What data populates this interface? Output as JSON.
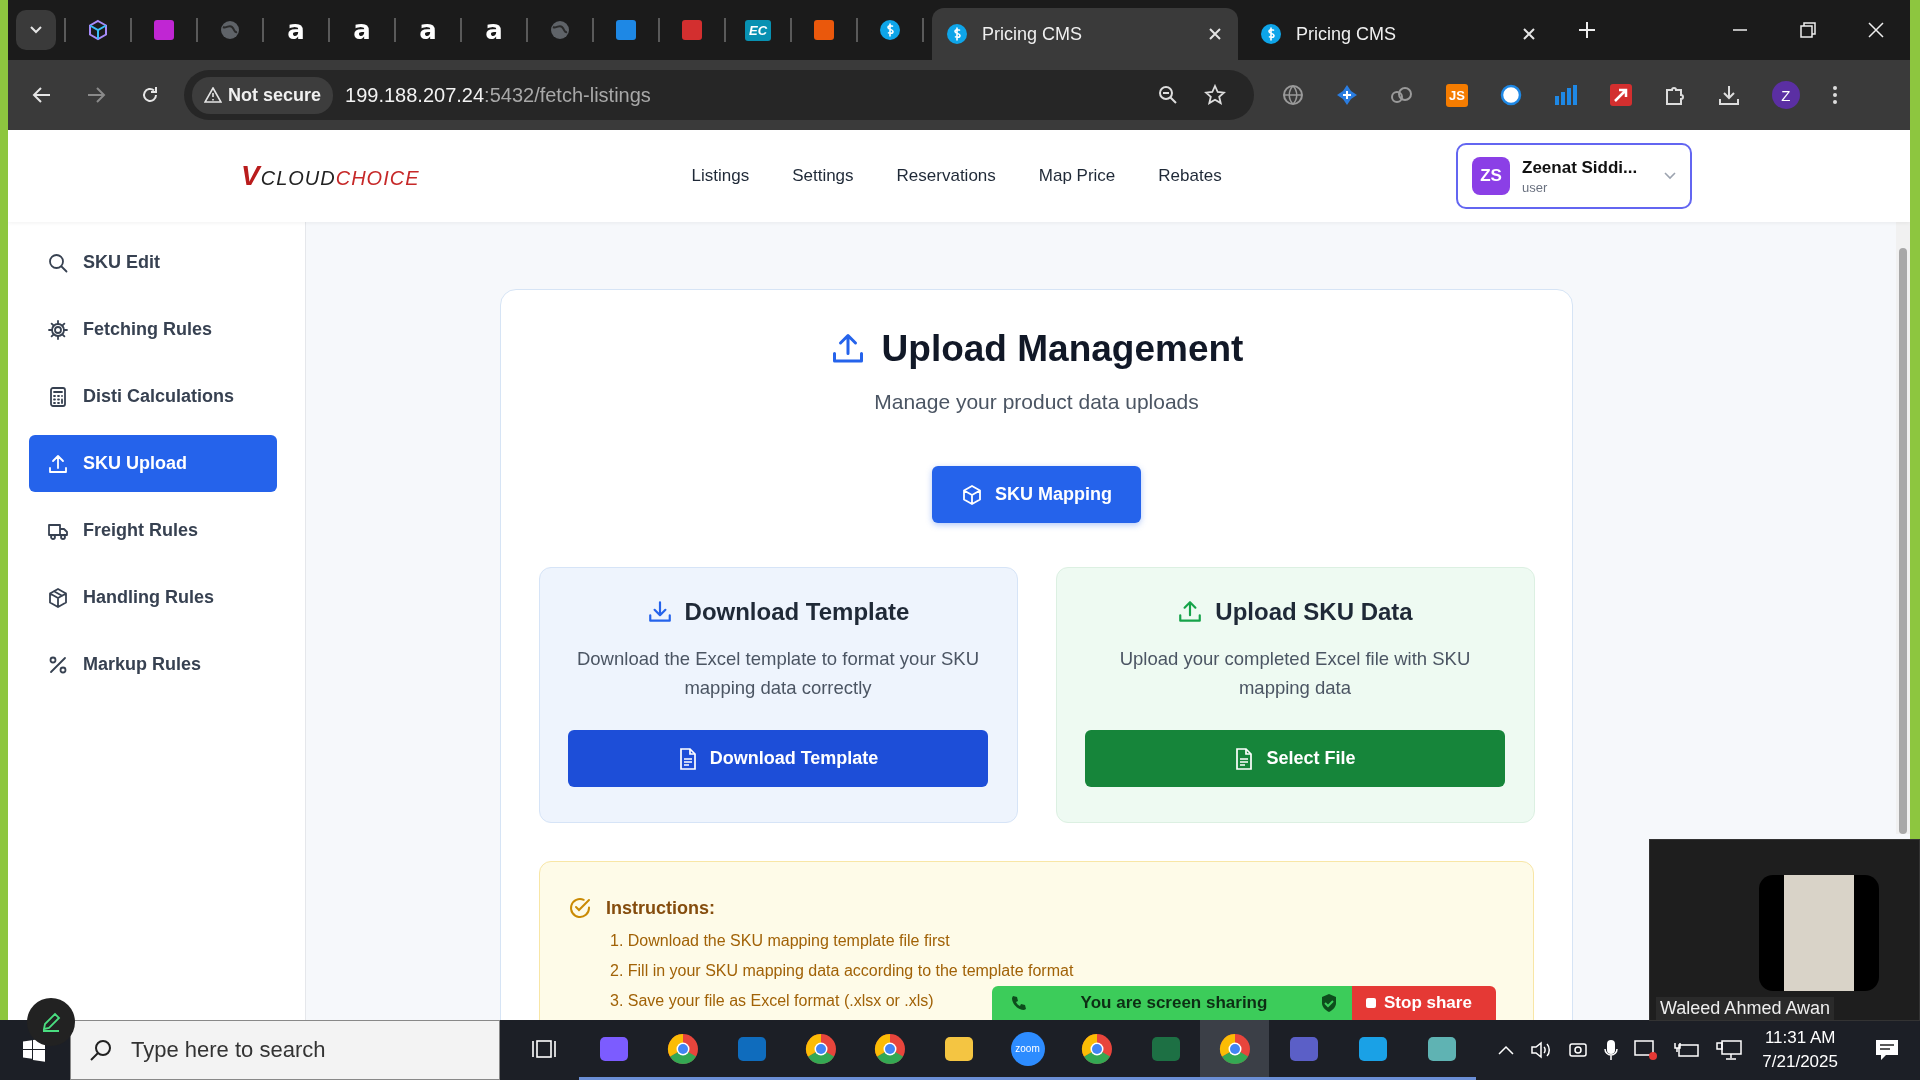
{
  "browser": {
    "pinned_tabs": [
      {
        "kind": "chevron"
      },
      {
        "kind": "cube"
      },
      {
        "kind": "heart"
      },
      {
        "kind": "globe"
      },
      {
        "kind": "amazon",
        "label": "a"
      },
      {
        "kind": "amazon",
        "label": "a"
      },
      {
        "kind": "amazon",
        "label": "a"
      },
      {
        "kind": "amazon",
        "label": "a"
      },
      {
        "kind": "globe"
      },
      {
        "kind": "square-blue"
      },
      {
        "kind": "square-red"
      },
      {
        "kind": "ec",
        "label": "EC"
      },
      {
        "kind": "stack"
      },
      {
        "kind": "dollar"
      }
    ],
    "tabs": [
      {
        "title": "Pricing CMS",
        "selected": true
      },
      {
        "title": "Pricing CMS",
        "selected": false
      }
    ],
    "security": "Not secure",
    "url_host": "199.188.207.24",
    "url_path": ":5432/fetch-listings",
    "extensions": [
      {
        "kind": "globe"
      },
      {
        "kind": "plus"
      },
      {
        "kind": "cloud"
      },
      {
        "kind": "js",
        "label": "JS"
      },
      {
        "kind": "circle"
      },
      {
        "kind": "bars"
      },
      {
        "kind": "arrow"
      },
      {
        "kind": "puzzle"
      }
    ],
    "profile": "Z"
  },
  "header": {
    "logo": {
      "mark": "V",
      "first": "CLOUD",
      "second": "CHOICE"
    },
    "nav": [
      "Listings",
      "Settings",
      "Reservations",
      "Map Price",
      "Rebates"
    ],
    "user": {
      "initials": "ZS",
      "name": "Zeenat Siddi...",
      "role": "user"
    }
  },
  "sidebar": {
    "items": [
      {
        "label": "SKU Edit",
        "kind": "search",
        "selected": false
      },
      {
        "label": "Fetching Rules",
        "kind": "gear",
        "selected": false
      },
      {
        "label": "Disti Calculations",
        "kind": "calculator",
        "selected": false
      },
      {
        "label": "SKU Upload",
        "kind": "upload",
        "selected": true
      },
      {
        "label": "Freight Rules",
        "kind": "truck",
        "selected": false
      },
      {
        "label": "Handling Rules",
        "kind": "box",
        "selected": false
      },
      {
        "label": "Markup Rules",
        "kind": "percent",
        "selected": false
      }
    ]
  },
  "main": {
    "title": "Upload Management",
    "subtitle": "Manage your product data uploads",
    "mapping_button": "SKU Mapping",
    "cards": [
      {
        "kind": "download",
        "title": "Download Template",
        "description": "Download the Excel template to format your SKU mapping data correctly",
        "button": "Download Template"
      },
      {
        "kind": "upload",
        "title": "Upload SKU Data",
        "description": "Upload your completed Excel file with SKU mapping data",
        "button": "Select File"
      }
    ],
    "instructions": {
      "title": "Instructions:",
      "items": [
        "1. Download the SKU mapping template file first",
        "2. Fill in your SKU mapping data according to the template format",
        "3. Save your file as Excel format (.xlsx or .xls)"
      ]
    }
  },
  "screen_share": {
    "message": "You are screen sharing",
    "stop": "Stop share"
  },
  "video": {
    "name": "Waleed Ahmed Awan"
  },
  "taskbar": {
    "search_placeholder": "Type here to search",
    "apps": [
      {
        "kind": "taskview",
        "selected": false
      },
      {
        "kind": "copilot",
        "selected": false
      },
      {
        "kind": "chrome",
        "selected": false
      },
      {
        "kind": "outlook",
        "selected": false
      },
      {
        "kind": "chrome",
        "selected": false
      },
      {
        "kind": "chrome",
        "selected": false
      },
      {
        "kind": "folder",
        "selected": false
      },
      {
        "kind": "zoom",
        "label": "zoom",
        "selected": false
      },
      {
        "kind": "chrome",
        "selected": false
      },
      {
        "kind": "excel",
        "selected": false
      },
      {
        "kind": "chrome",
        "selected": true
      },
      {
        "kind": "teams",
        "selected": false
      },
      {
        "kind": "edge",
        "selected": false
      },
      {
        "kind": "diamond",
        "selected": false
      }
    ],
    "time": "11:31 AM",
    "date": "7/21/2025"
  }
}
